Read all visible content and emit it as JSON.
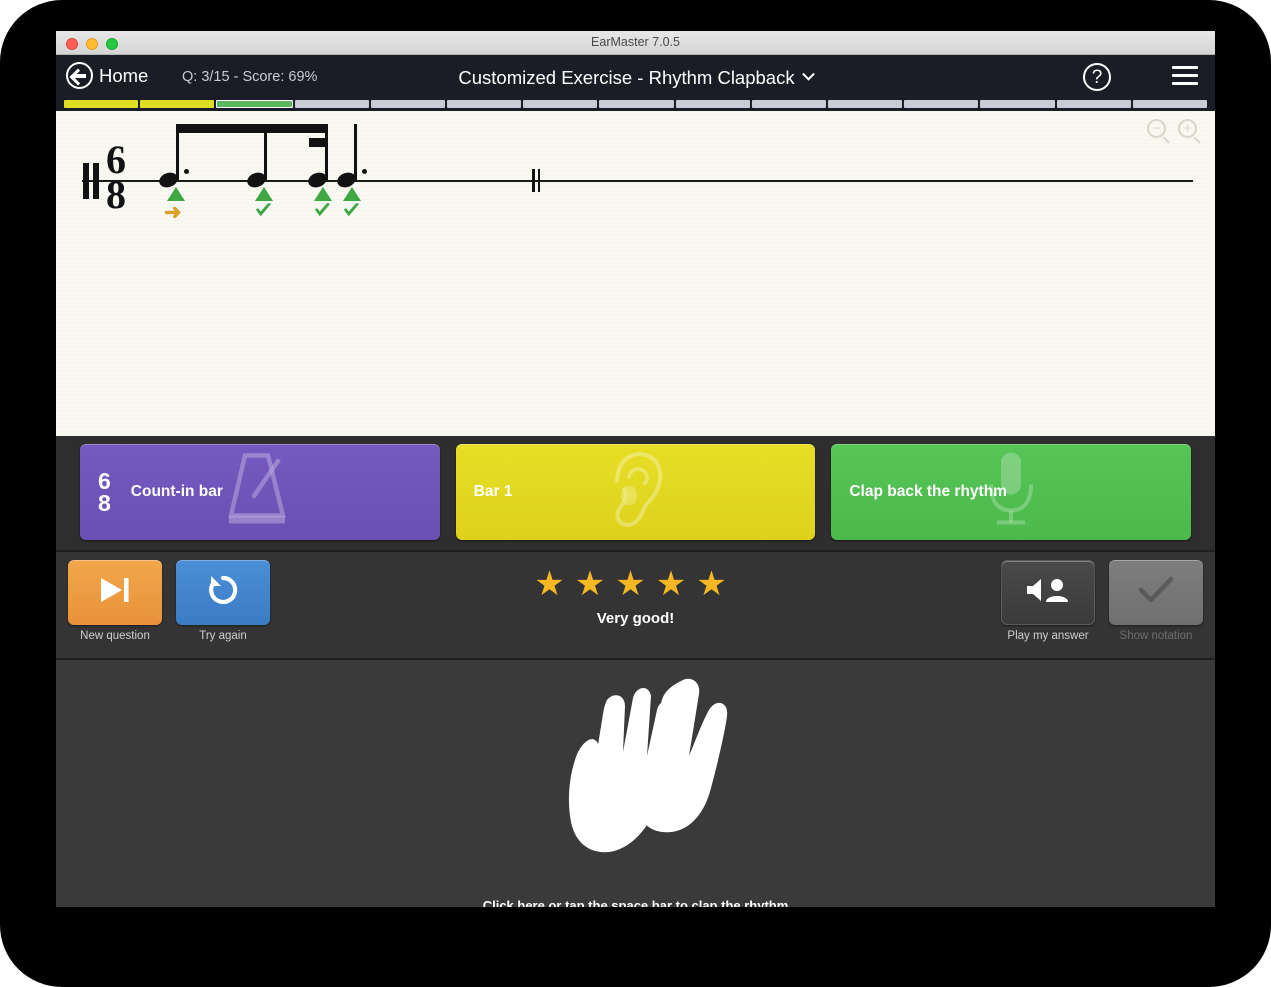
{
  "window": {
    "title": "EarMaster 7.0.5",
    "traffic_lights": [
      "close",
      "minimize",
      "maximize"
    ]
  },
  "toolbar": {
    "home_label": "Home",
    "home_icon": "back-arrow-circle-icon",
    "progress_status": "Q: 3/15 - Score: 69%",
    "exercise_title": "Customized Exercise - Rhythm Clapback",
    "title_dropdown_icon": "chevron-down-icon",
    "help_label": "?",
    "help_icon": "question-mark-circle-icon",
    "menu_icon": "hamburger-menu-icon"
  },
  "question_progress": {
    "total": 15,
    "current_index": 3,
    "segments": [
      "correct",
      "correct",
      "current",
      "pending",
      "pending",
      "pending",
      "pending",
      "pending",
      "pending",
      "pending",
      "pending",
      "pending",
      "pending",
      "pending",
      "pending"
    ],
    "colors": {
      "correct": "#dede24",
      "current": "#5cb85c",
      "pending": "#c9cbd6"
    }
  },
  "score": {
    "clef": "percussion-clef",
    "time_signature": {
      "numerator": "6",
      "denominator": "8"
    },
    "zoom_out_label": "−",
    "zoom_in_label": "+",
    "zoom_out_icon": "zoom-out-icon",
    "zoom_in_icon": "zoom-in-icon",
    "barline": "double-barline",
    "notes": [
      {
        "id": 1,
        "dotted": true,
        "marker": "triangle",
        "result": "pending",
        "result_icon": "arrow-right-icon"
      },
      {
        "id": 2,
        "dotted": false,
        "marker": "triangle",
        "result": "correct",
        "result_icon": "check-icon"
      },
      {
        "id": 3,
        "dotted": false,
        "marker": "triangle",
        "result": "correct",
        "result_icon": "check-icon"
      },
      {
        "id": 4,
        "dotted": true,
        "marker": "triangle",
        "result": "correct",
        "result_icon": "check-icon"
      }
    ],
    "marker_color": "#3fa845",
    "pointer_color": "#d6a22a",
    "paper_color": "#f9f8f1"
  },
  "panels": [
    {
      "key": "count-in",
      "label": "Count-in bar",
      "timesig_top": "6",
      "timesig_bottom": "8",
      "icon": "metronome-icon",
      "color": "#7559bf"
    },
    {
      "key": "bar-1",
      "label": "Bar 1",
      "icon": "ear-icon",
      "color": "#e8de26"
    },
    {
      "key": "clap-back",
      "label": "Clap back the rhythm",
      "icon": "microphone-icon",
      "color": "#57c457"
    }
  ],
  "controls": {
    "new_question": {
      "label": "New question",
      "icon": "skip-next-icon",
      "color": "#f2a74b",
      "enabled": true
    },
    "try_again": {
      "label": "Try again",
      "icon": "reload-icon",
      "color": "#4a8fd8",
      "enabled": true
    },
    "play_answer": {
      "label": "Play my answer",
      "icon": "speaker-person-icon",
      "enabled": true
    },
    "show_notation": {
      "label": "Show notation",
      "icon": "check-icon",
      "enabled": false
    }
  },
  "rating": {
    "stars_filled": 5,
    "stars_total": 5,
    "star_glyph": "★",
    "star_color": "#f5b824",
    "text": "Very good!"
  },
  "clap_pad": {
    "icon": "clapping-hands-icon",
    "instruction": "Click here or tap the space bar to clap the rhythm"
  }
}
